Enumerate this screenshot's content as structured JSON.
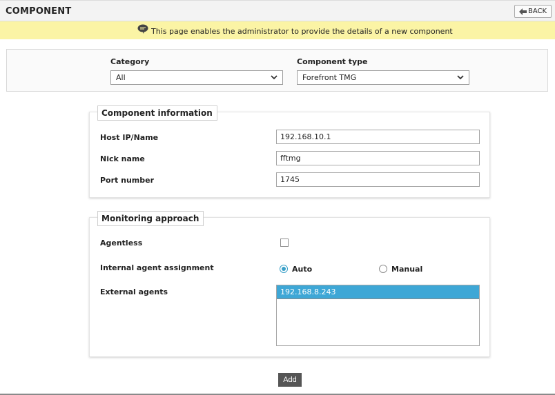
{
  "header": {
    "title": "COMPONENT",
    "back_label": "BACK"
  },
  "info": {
    "message": "This page enables the administrator to provide the details of a new component",
    "icon": "speech-bubble-icon"
  },
  "filters": {
    "category_label": "Category",
    "category_value": "All",
    "component_type_label": "Component type",
    "component_type_value": "Forefront TMG"
  },
  "component_info": {
    "legend": "Component information",
    "host_label": "Host IP/Name",
    "host_value": "192.168.10.1",
    "nick_label": "Nick name",
    "nick_value": "fftmg",
    "port_label": "Port number",
    "port_value": "1745"
  },
  "monitoring": {
    "legend": "Monitoring approach",
    "agentless_label": "Agentless",
    "agentless_checked": false,
    "internal_label": "Internal agent assignment",
    "auto_label": "Auto",
    "manual_label": "Manual",
    "internal_selected": "Auto",
    "external_label": "External agents",
    "external_agents": [
      "192.168.8.243"
    ]
  },
  "actions": {
    "add_label": "Add"
  },
  "colors": {
    "accent": "#3ea7d6",
    "info_bg": "#fbf4a5",
    "button_dark": "#555555"
  }
}
